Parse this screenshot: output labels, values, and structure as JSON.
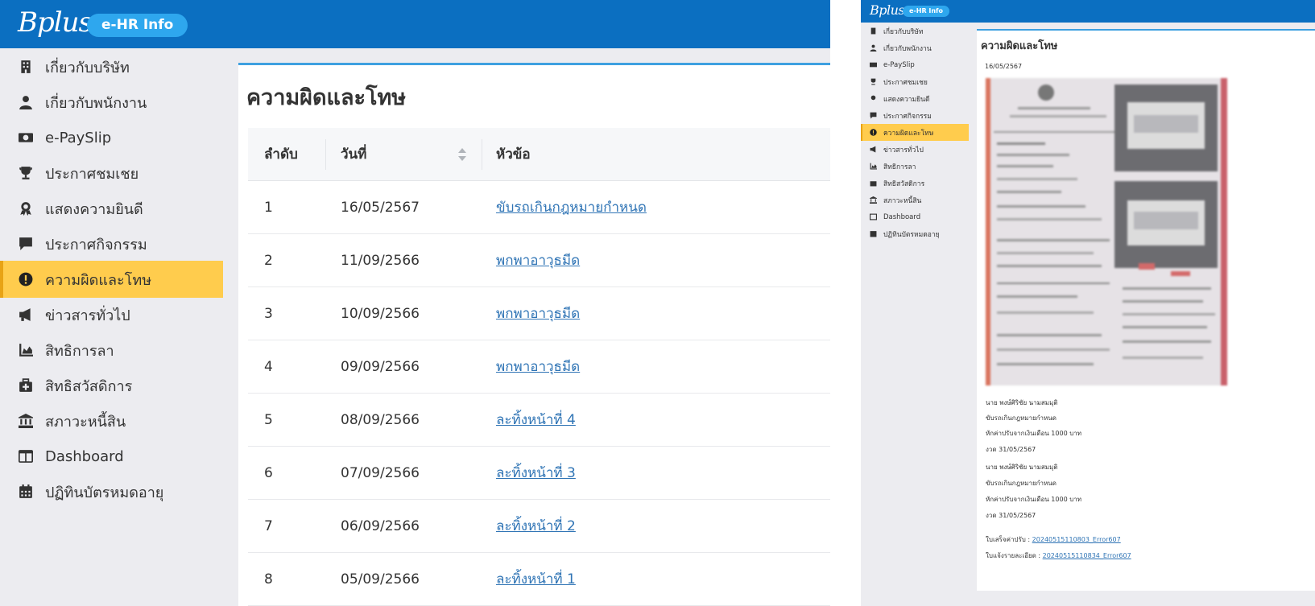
{
  "brand": {
    "logo": "Bplus",
    "app_badge": "e-HR Info"
  },
  "sidebar": {
    "items": [
      {
        "label": "เกี่ยวกับบริษัท",
        "icon": "building-icon"
      },
      {
        "label": "เกี่ยวกับพนักงาน",
        "icon": "user-icon"
      },
      {
        "label": "e-PaySlip",
        "icon": "money-icon"
      },
      {
        "label": "ประกาศชมเชย",
        "icon": "trophy-icon"
      },
      {
        "label": "แสดงความยินดี",
        "icon": "award-icon"
      },
      {
        "label": "ประกาศกิจกรรม",
        "icon": "comment-icon"
      },
      {
        "label": "ความผิดและโทษ",
        "icon": "exclamation-icon",
        "active": true
      },
      {
        "label": "ข่าวสารทั่วไป",
        "icon": "megaphone-icon"
      },
      {
        "label": "สิทธิการลา",
        "icon": "area-chart-icon"
      },
      {
        "label": "สิทธิสวัสดิการ",
        "icon": "medical-kit-icon"
      },
      {
        "label": "สภาวะหนี้สิน",
        "icon": "bank-icon"
      },
      {
        "label": "Dashboard",
        "icon": "dashboard-icon"
      },
      {
        "label": "ปฏิทินบัตรหมดอายุ",
        "icon": "calendar-icon"
      }
    ]
  },
  "page": {
    "title": "ความผิดและโทษ"
  },
  "table": {
    "headers": {
      "no": "ลำดับ",
      "date": "วันที่",
      "subject": "หัวข้อ"
    },
    "rows": [
      {
        "no": "1",
        "date": "16/05/2567",
        "subject": "ขับรถเกินกฎหมายกำหนด"
      },
      {
        "no": "2",
        "date": "11/09/2566",
        "subject": "พกพาอาวุธมีด"
      },
      {
        "no": "3",
        "date": "10/09/2566",
        "subject": "พกพาอาวุธมีด"
      },
      {
        "no": "4",
        "date": "09/09/2566",
        "subject": "พกพาอาวุธมีด"
      },
      {
        "no": "5",
        "date": "08/09/2566",
        "subject": "ละทิ้งหน้าที่ 4"
      },
      {
        "no": "6",
        "date": "07/09/2566",
        "subject": "ละทิ้งหน้าที่ 3"
      },
      {
        "no": "7",
        "date": "06/09/2566",
        "subject": "ละทิ้งหน้าที่ 2"
      },
      {
        "no": "8",
        "date": "05/09/2566",
        "subject": "ละทิ้งหน้าที่ 1"
      }
    ]
  },
  "detail": {
    "title": "ความผิดและโทษ",
    "date": "16/05/2567",
    "lines": [
      "นาย พงษ์ศิริชัย นามสมมุติ",
      "ขับรถเกินกฎหมายกำหนด",
      "หักค่าปรับจากเงินเดือน 1000 บาท",
      "งวด 31/05/2567",
      "นาย พงษ์ศิริชัย นามสมมุติ",
      "ขับรถเกินกฎหมายกำหนด",
      "หักค่าปรับจากเงินเดือน 1000 บาท",
      "งวด 31/05/2567"
    ],
    "attachments": [
      {
        "label": "ใบเสร็จค่าปรับ :",
        "file": "20240515110803_Error607"
      },
      {
        "label": "ใบแจ้งรายละเอียด :",
        "file": "20240515110834_Error607"
      }
    ]
  }
}
